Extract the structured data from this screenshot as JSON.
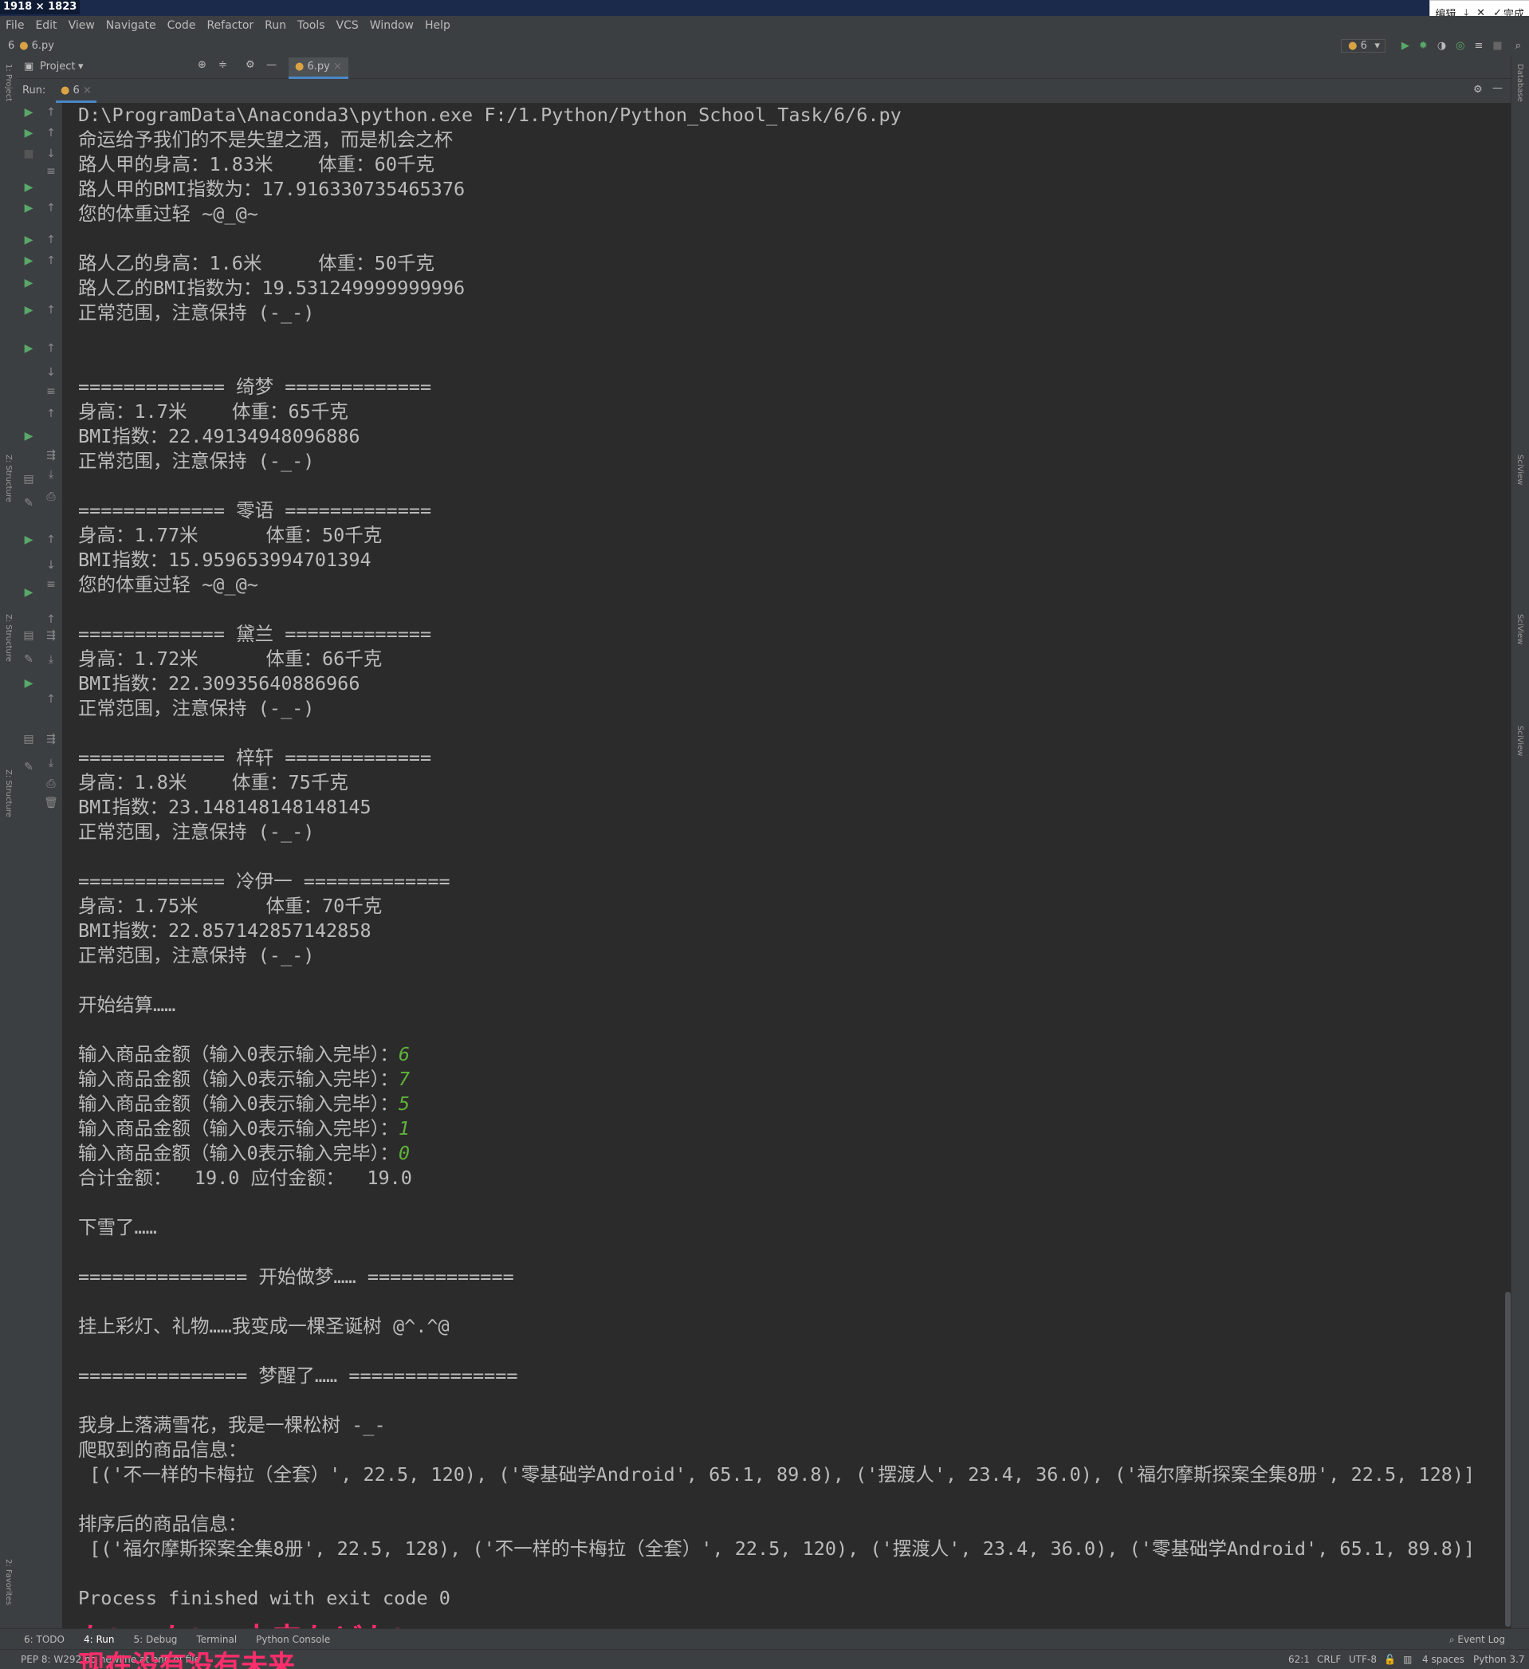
{
  "screen_label": "1918 × 1823",
  "snip_toolbar": {
    "edit": "编辑",
    "done": "完成"
  },
  "menu": [
    "File",
    "Edit",
    "View",
    "Navigate",
    "Code",
    "Refactor",
    "Run",
    "Tools",
    "VCS",
    "Window",
    "Help"
  ],
  "nav": {
    "project_num": "6",
    "file": "6.py",
    "run_config": "6"
  },
  "project_panel": {
    "label": "Project",
    "tab": "6.py"
  },
  "run_panel": {
    "label": "Run:",
    "config": "6"
  },
  "side_labels": {
    "project": "1: Project",
    "structure": "Z: Structure",
    "favorites": "2: Favorites",
    "database": "Database",
    "scview": "SciView"
  },
  "console_lines": [
    {
      "text": "D:\\ProgramData\\Anaconda3\\python.exe F:/1.Python/Python_School_Task/6/6.py"
    },
    {
      "text": "命运给予我们的不是失望之酒，而是机会之杯"
    },
    {
      "text": "路人甲的身高：1.83米    体重：60千克"
    },
    {
      "text": "路人甲的BMI指数为：17.916330735465376"
    },
    {
      "text": "您的体重过轻 ~@_@~"
    },
    {
      "text": ""
    },
    {
      "text": "路人乙的身高：1.6米     体重：50千克"
    },
    {
      "text": "路人乙的BMI指数为：19.531249999999996"
    },
    {
      "text": "正常范围，注意保持 (-_-)"
    },
    {
      "text": ""
    },
    {
      "text": ""
    },
    {
      "text": "============= 绮梦 ============="
    },
    {
      "text": "身高：1.7米    体重：65千克"
    },
    {
      "text": "BMI指数：22.49134948096886"
    },
    {
      "text": "正常范围，注意保持 (-_-)"
    },
    {
      "text": ""
    },
    {
      "text": "============= 零语 ============="
    },
    {
      "text": "身高：1.77米      体重：50千克"
    },
    {
      "text": "BMI指数：15.959653994701394"
    },
    {
      "text": "您的体重过轻 ~@_@~"
    },
    {
      "text": ""
    },
    {
      "text": "============= 黛兰 ============="
    },
    {
      "text": "身高：1.72米      体重：66千克"
    },
    {
      "text": "BMI指数：22.30935640886966"
    },
    {
      "text": "正常范围，注意保持 (-_-)"
    },
    {
      "text": ""
    },
    {
      "text": "============= 梓轩 ============="
    },
    {
      "text": "身高：1.8米    体重：75千克"
    },
    {
      "text": "BMI指数：23.148148148148145"
    },
    {
      "text": "正常范围，注意保持 (-_-)"
    },
    {
      "text": ""
    },
    {
      "text": "============= 冷伊一 ============="
    },
    {
      "text": "身高：1.75米      体重：70千克"
    },
    {
      "text": "BMI指数：22.857142857142858"
    },
    {
      "text": "正常范围，注意保持 (-_-)"
    },
    {
      "text": ""
    },
    {
      "text": "开始结算……"
    },
    {
      "text": ""
    },
    {
      "text": "输入商品金额（输入0表示输入完毕）：",
      "input": "6"
    },
    {
      "text": "输入商品金额（输入0表示输入完毕）：",
      "input": "7"
    },
    {
      "text": "输入商品金额（输入0表示输入完毕）：",
      "input": "5"
    },
    {
      "text": "输入商品金额（输入0表示输入完毕）：",
      "input": "1"
    },
    {
      "text": "输入商品金额（输入0表示输入完毕）：",
      "input": "0"
    },
    {
      "text": "合计金额：  19.0 应付金额：  19.0"
    },
    {
      "text": ""
    },
    {
      "text": "下雪了……"
    },
    {
      "text": ""
    },
    {
      "text": "=============== 开始做梦…… ============="
    },
    {
      "text": ""
    },
    {
      "text": "挂上彩灯、礼物……我变成一棵圣诞树 @^.^@"
    },
    {
      "text": ""
    },
    {
      "text": "=============== 梦醒了…… ==============="
    },
    {
      "text": ""
    },
    {
      "text": "我身上落满雪花，我是一棵松树 -_-"
    },
    {
      "text": "爬取到的商品信息："
    },
    {
      "text": " [('不一样的卡梅拉（全套）', 22.5, 120), ('零基础学Android', 65.1, 89.8), ('摆渡人', 23.4, 36.0), ('福尔摩斯探案全集8册', 22.5, 128)]"
    },
    {
      "text": ""
    },
    {
      "text": "排序后的商品信息："
    },
    {
      "text": " [('福尔摩斯探案全集8册', 22.5, 128), ('不一样的卡梅拉（全套）', 22.5, 120), ('摆渡人', 23.4, 36.0), ('零基础学Android', 65.1, 89.8)]"
    },
    {
      "text": ""
    },
    {
      "text": "Process finished with exit code 0"
    }
  ],
  "overlay_text": {
    "line1": "ない  ない  未来などない",
    "line2": "现在没有没有未来"
  },
  "tool_windows": {
    "todo": "6: TODO",
    "run": "4: Run",
    "debug": "5: Debug",
    "terminal": "Terminal",
    "python_console": "Python Console",
    "event_log": "Event Log"
  },
  "status": {
    "message": "PEP 8: W292 no newline at end of file",
    "position": "62:1",
    "line_sep": "CRLF",
    "encoding": "UTF-8",
    "indent": "4 spaces",
    "interpreter": "Python 3.7"
  },
  "colors": {
    "bg": "#2b2b2b",
    "panel": "#3c3f41",
    "text": "#bbbbbb",
    "input": "#5fb23b",
    "overlay": "#ff2d6b"
  }
}
